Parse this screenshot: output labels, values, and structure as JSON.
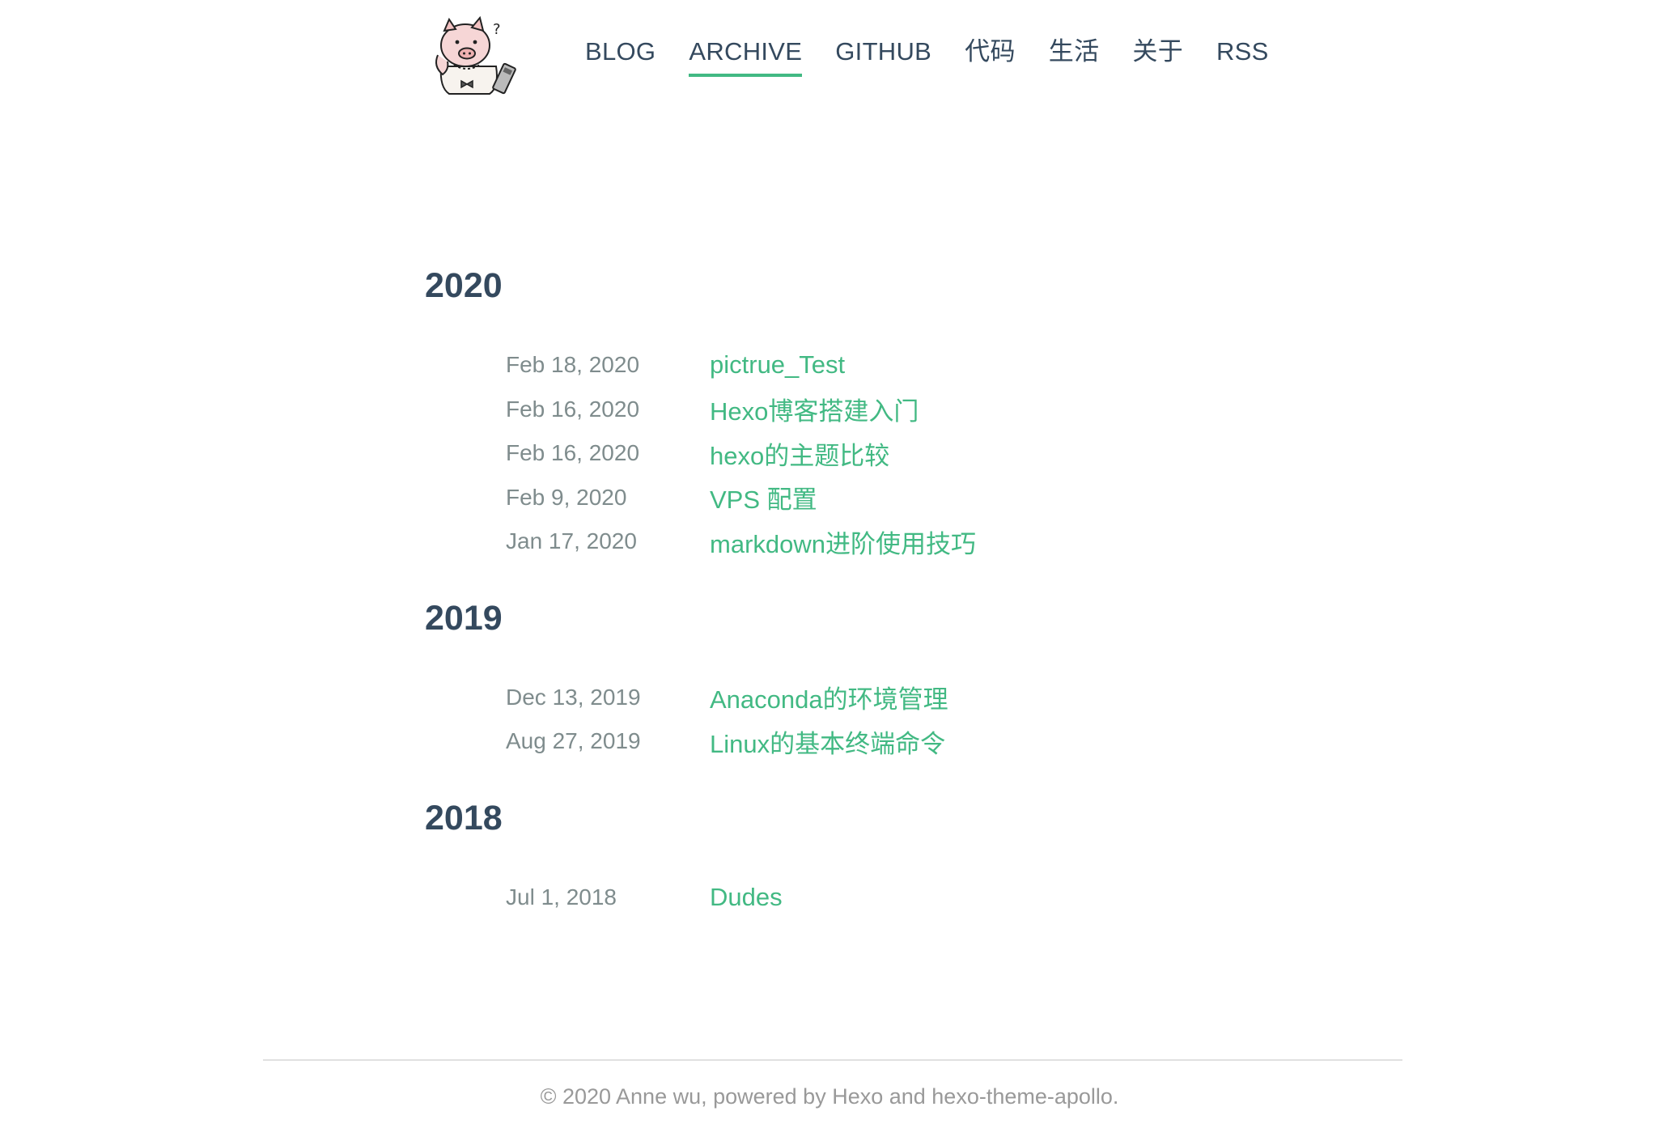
{
  "header": {
    "nav": [
      {
        "label": "BLOG",
        "active": false
      },
      {
        "label": "ARCHIVE",
        "active": true
      },
      {
        "label": "GITHUB",
        "active": false
      },
      {
        "label": "代码",
        "active": false
      },
      {
        "label": "生活",
        "active": false
      },
      {
        "label": "关于",
        "active": false
      },
      {
        "label": "RSS",
        "active": false
      }
    ]
  },
  "archive": {
    "years": [
      {
        "year": "2020",
        "posts": [
          {
            "date": "Feb 18, 2020",
            "title": "pictrue_Test"
          },
          {
            "date": "Feb 16, 2020",
            "title": "Hexo博客搭建入门"
          },
          {
            "date": "Feb 16, 2020",
            "title": "hexo的主题比较"
          },
          {
            "date": "Feb 9, 2020",
            "title": "VPS 配置"
          },
          {
            "date": "Jan 17, 2020",
            "title": "markdown进阶使用技巧"
          }
        ]
      },
      {
        "year": "2019",
        "posts": [
          {
            "date": "Dec 13, 2019",
            "title": "Anaconda的环境管理"
          },
          {
            "date": "Aug 27, 2019",
            "title": "Linux的基本终端命令"
          }
        ]
      },
      {
        "year": "2018",
        "posts": [
          {
            "date": "Jul 1, 2018",
            "title": "Dudes"
          }
        ]
      }
    ]
  },
  "footer": {
    "text": "© 2020 Anne wu, powered by Hexo and hexo-theme-apollo."
  },
  "colors": {
    "accent": "#42b983",
    "text": "#34495e",
    "muted": "#7f8c8d"
  }
}
